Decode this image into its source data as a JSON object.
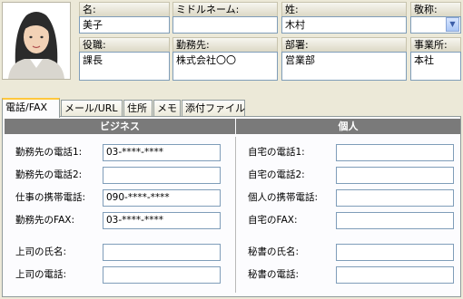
{
  "header": {
    "name": {
      "label": "名:",
      "value": "美子"
    },
    "middle_name": {
      "label": "ミドルネーム:",
      "value": ""
    },
    "surname": {
      "label": "姓:",
      "value": "木村"
    },
    "honorific": {
      "label": "敬称:",
      "value": ""
    },
    "position": {
      "label": "役職:",
      "value": "課長"
    },
    "company": {
      "label": "勤務先:",
      "value": "株式会社〇〇"
    },
    "department": {
      "label": "部署:",
      "value": "営業部"
    },
    "office": {
      "label": "事業所:",
      "value": "本社"
    }
  },
  "tabs": [
    {
      "label": "電話/FAX",
      "active": true
    },
    {
      "label": "メール/URL",
      "active": false
    },
    {
      "label": "住所",
      "active": false
    },
    {
      "label": "メモ",
      "active": false
    },
    {
      "label": "添付ファイル",
      "active": false
    }
  ],
  "business": {
    "title": "ビジネス",
    "work_phone1": {
      "label": "勤務先の電話1:",
      "value": "03-****-****"
    },
    "work_phone2": {
      "label": "勤務先の電話2:",
      "value": ""
    },
    "work_mobile": {
      "label": "仕事の携帯電話:",
      "value": "090-****-****"
    },
    "work_fax": {
      "label": "勤務先のFAX:",
      "value": "03-****-****"
    },
    "boss_name": {
      "label": "上司の氏名:",
      "value": ""
    },
    "boss_phone": {
      "label": "上司の電話:",
      "value": ""
    }
  },
  "personal": {
    "title": "個人",
    "home_phone1": {
      "label": "自宅の電話1:",
      "value": ""
    },
    "home_phone2": {
      "label": "自宅の電話2:",
      "value": ""
    },
    "personal_mobile": {
      "label": "個人の携帯電話:",
      "value": ""
    },
    "home_fax": {
      "label": "自宅のFAX:",
      "value": ""
    },
    "secretary_name": {
      "label": "秘書の氏名:",
      "value": ""
    },
    "secretary_phone": {
      "label": "秘書の電話:",
      "value": ""
    }
  },
  "colors": {
    "section_header": "#7a7a7a",
    "field_border": "#7f9db9",
    "window_bg": "#ece9d8",
    "tab_active_accent": "#ffc73c"
  }
}
